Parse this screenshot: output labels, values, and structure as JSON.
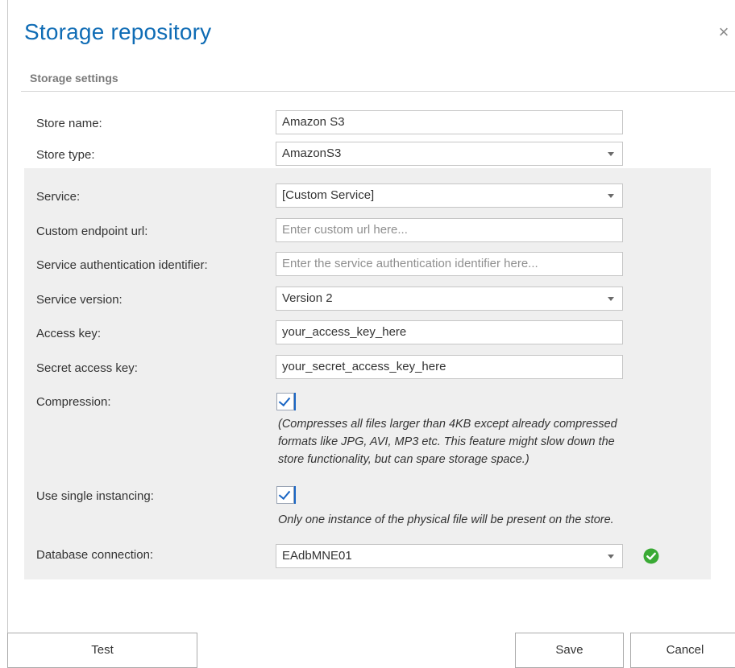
{
  "dialog": {
    "title": "Storage repository",
    "close_glyph": "×"
  },
  "section": {
    "title": "Storage settings"
  },
  "fields": {
    "store_name": {
      "label": "Store name:",
      "value": "Amazon S3"
    },
    "store_type": {
      "label": "Store type:",
      "value": "AmazonS3"
    },
    "service": {
      "label": "Service:",
      "value": "[Custom Service]"
    },
    "custom_endpoint": {
      "label": "Custom endpoint url:",
      "placeholder": "Enter custom url here..."
    },
    "service_auth": {
      "label": "Service authentication identifier:",
      "placeholder": "Enter the service authentication identifier here..."
    },
    "service_version": {
      "label": "Service version:",
      "value": "Version 2"
    },
    "access_key": {
      "label": "Access key:",
      "value": "your_access_key_here"
    },
    "secret_key": {
      "label": "Secret access key:",
      "value": "your_secret_access_key_here"
    },
    "compression": {
      "label": "Compression:",
      "checked": true,
      "hint_lines": [
        "(Compresses all files larger than 4KB except already compressed",
        "formats like JPG, AVI, MP3 etc. This feature might slow down the",
        "store functionality, but can spare storage space.)"
      ]
    },
    "single_instancing": {
      "label": "Use single instancing:",
      "checked": true,
      "hint": "Only one instance of the physical file will be present on the store."
    },
    "database_connection": {
      "label": "Database connection:",
      "value": "EAdbMNE01",
      "status_icon": "check-circle-icon",
      "status_color": "#3aaa35"
    }
  },
  "buttons": {
    "test": "Test",
    "save": "Save",
    "cancel": "Cancel"
  },
  "colors": {
    "title": "#0f6cb5",
    "panel": "#efefef",
    "accent": "#1a66c4"
  }
}
